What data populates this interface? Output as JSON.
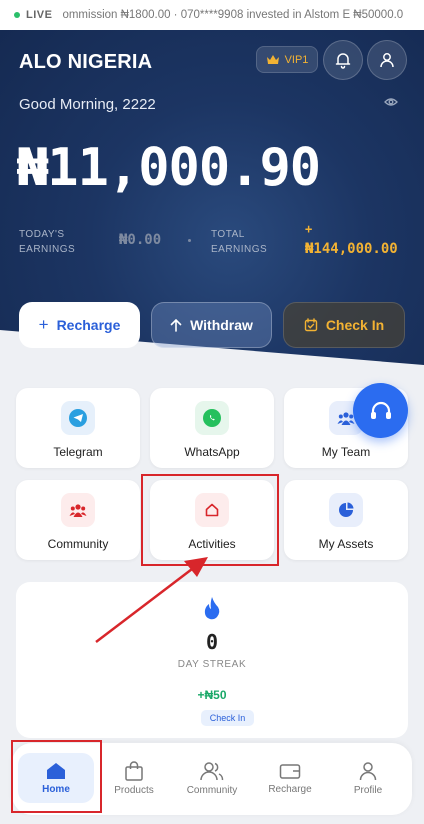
{
  "ticker": {
    "live_label": "LIVE",
    "text": "ommission ₦1800.00 · 070****9908 invested in Alstom E ₦50000.0"
  },
  "header": {
    "brand": "ALO NIGERIA",
    "vip_label": "VIP1",
    "greeting": "Good Morning, 2222",
    "balance": "₦11,000.90"
  },
  "earnings": {
    "today_label_line1": "TODAY'S",
    "today_label_line2": "EARNINGS",
    "today_value": "₦0.00",
    "total_label_line1": "TOTAL",
    "total_label_line2": "EARNINGS",
    "total_plus": "+",
    "total_value": "₦144,000.00"
  },
  "actions": {
    "recharge": "Recharge",
    "withdraw": "Withdraw",
    "checkin": "Check In"
  },
  "tiles": {
    "telegram": "Telegram",
    "whatsapp": "WhatsApp",
    "my_team": "My Team",
    "community": "Community",
    "activities": "Activities",
    "my_assets": "My Assets"
  },
  "streak": {
    "value": "0",
    "label": "DAY STREAK",
    "reward": "+₦50",
    "checkin": "Check In"
  },
  "nav": {
    "home": "Home",
    "products": "Products",
    "community": "Community",
    "recharge": "Recharge",
    "profile": "Profile"
  },
  "colors": {
    "accent": "#2b60d9",
    "gold": "#f2b233",
    "hero": "#1c3563",
    "annotation": "#d8262b"
  }
}
